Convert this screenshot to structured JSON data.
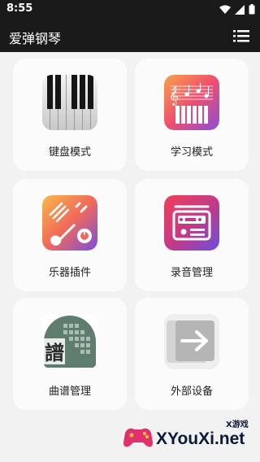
{
  "status_bar": {
    "time": "8:55"
  },
  "app_bar": {
    "title": "爱弹钢琴",
    "menu_icon": "list-menu-icon"
  },
  "tiles": [
    {
      "label": "键盘模式",
      "icon": "piano-keyboard-icon"
    },
    {
      "label": "学习模式",
      "icon": "music-score-piano-icon"
    },
    {
      "label": "乐器插件",
      "icon": "instrument-plugin-icon"
    },
    {
      "label": "录音管理",
      "icon": "radio-recorder-icon"
    },
    {
      "label": "曲谱管理",
      "icon": "score-book-icon"
    },
    {
      "label": "外部设备",
      "icon": "external-device-arrow-icon"
    }
  ],
  "watermark": {
    "brand": "XYouXi.net",
    "tag": "X游戏"
  },
  "colors": {
    "bar": "#1a1a1a",
    "background": "#f2f2f2",
    "tile": "#fbfbfb"
  }
}
